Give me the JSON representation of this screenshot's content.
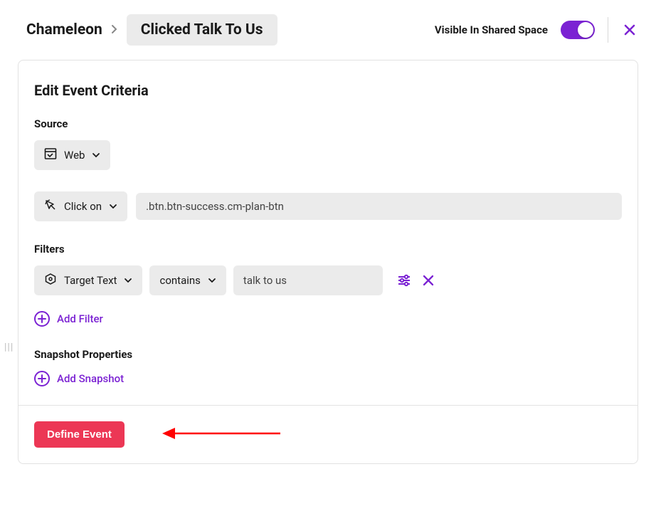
{
  "header": {
    "breadcrumb_root": "Chameleon",
    "breadcrumb_current": "Clicked Talk To Us",
    "visible_label": "Visible In Shared Space",
    "toggle_on": true
  },
  "card": {
    "title": "Edit Event Criteria",
    "source_label": "Source",
    "source_value": "Web",
    "action_label": "Click on",
    "selector_value": ".btn.btn-success.cm-plan-btn",
    "filters_label": "Filters",
    "filter": {
      "property": "Target Text",
      "operator": "contains",
      "value": "talk to us"
    },
    "add_filter_label": "Add Filter",
    "snapshot_label": "Snapshot Properties",
    "add_snapshot_label": "Add Snapshot",
    "define_button_label": "Define Event"
  },
  "colors": {
    "accent": "#7b22d3",
    "danger": "#ec3755"
  }
}
